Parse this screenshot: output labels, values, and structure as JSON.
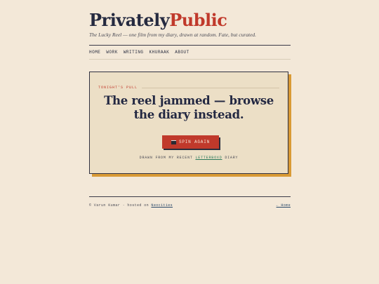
{
  "brand": {
    "part1": "Privately",
    "part2": "Public"
  },
  "tagline": "The Lucky Reel — one film from my diary, drawn at random. Fate, but curated.",
  "nav": [
    "HOME",
    "WORK",
    "WRITING",
    "KHURAAK",
    "ABOUT"
  ],
  "card": {
    "kicker": "TONIGHT'S PULL",
    "headline_line1": "The reel jammed — browse",
    "headline_line2": "the diary instead.",
    "button_label": "SPIN AGAIN",
    "source_prefix": "DRAWN FROM MY RECENT",
    "source_link": "LETTERBOXD",
    "source_suffix": "DIARY"
  },
  "footer": {
    "left_prefix": "© Varun Kumar · hosted on",
    "left_link": "Neocities",
    "right_link": "← Home"
  },
  "colors": {
    "accent": "#c0392b",
    "background": "#f3e8d8",
    "card": "#ecdfc6",
    "shadow": "#d99a35",
    "link": "#2b7a5a"
  },
  "icons": {
    "button_icon": "clapperboard-icon"
  }
}
